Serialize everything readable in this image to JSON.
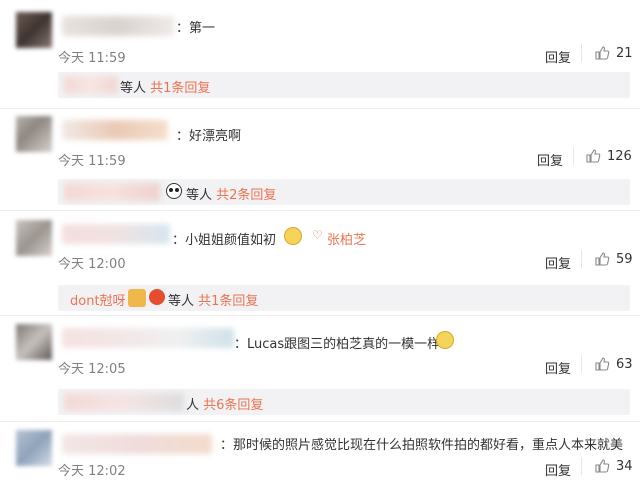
{
  "colors": {
    "orange": "#eb7350",
    "gray": "#808080",
    "text": "#333333",
    "sub_bg": "#f2f2f5"
  },
  "comments": [
    {
      "text": "：第一",
      "time": "今天 11:59",
      "reply": "回复",
      "likes": "21",
      "sub": {
        "who": "等人",
        "link": "共1条回复"
      }
    },
    {
      "text": "：好漂亮啊",
      "time": "今天 11:59",
      "reply": "回复",
      "likes": "126",
      "sub": {
        "who": "等人",
        "link": "共2条回复"
      }
    },
    {
      "text": "：小姐姐颜值如初",
      "mention": "张柏芝",
      "time": "今天 12:00",
      "reply": "回复",
      "likes": "59",
      "sub": {
        "name": "dont尅呀",
        "who": "等人",
        "link": "共1条回复"
      }
    },
    {
      "text": "：Lucas跟图三的柏芝真的一模一样",
      "time": "今天 12:05",
      "reply": "回复",
      "likes": "63",
      "sub": {
        "who": "人",
        "link": "共6条回复"
      }
    },
    {
      "text": "：那时候的照片感觉比现在什么拍照软件拍的都好看，重点人本来就美",
      "time": "今天 12:02",
      "reply": "回复",
      "likes": "34"
    }
  ]
}
